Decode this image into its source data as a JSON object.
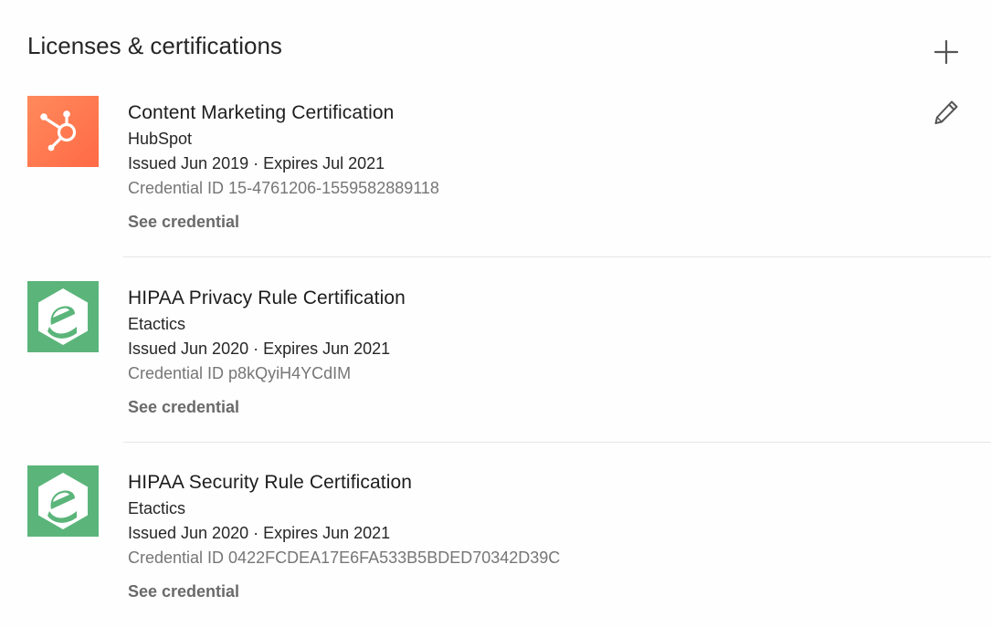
{
  "section": {
    "title": "Licenses & certifications",
    "add_icon": "plus-icon",
    "edit_icon": "pencil-icon"
  },
  "colors": {
    "hubspot_orange": "#ff7a59",
    "etactics_green": "#5bb57a",
    "muted_text": "#767676",
    "link_text": "#6a6a6a"
  },
  "certifications": [
    {
      "name": "Content Marketing Certification",
      "issuer": "HubSpot",
      "dates": "Issued Jun 2019 · Expires Jul 2021",
      "credential_id": "Credential ID 15-4761206-1559582889118",
      "link_label": "See credential",
      "logo": "hubspot-logo"
    },
    {
      "name": "HIPAA Privacy Rule Certification",
      "issuer": "Etactics",
      "dates": "Issued Jun 2020 · Expires Jun 2021",
      "credential_id": "Credential ID p8kQyiH4YCdIM",
      "link_label": "See credential",
      "logo": "etactics-logo"
    },
    {
      "name": "HIPAA Security Rule Certification",
      "issuer": "Etactics",
      "dates": "Issued Jun 2020 · Expires Jun 2021",
      "credential_id": "Credential ID 0422FCDEA17E6FA533B5BDED70342D39C",
      "link_label": "See credential",
      "logo": "etactics-logo"
    }
  ]
}
